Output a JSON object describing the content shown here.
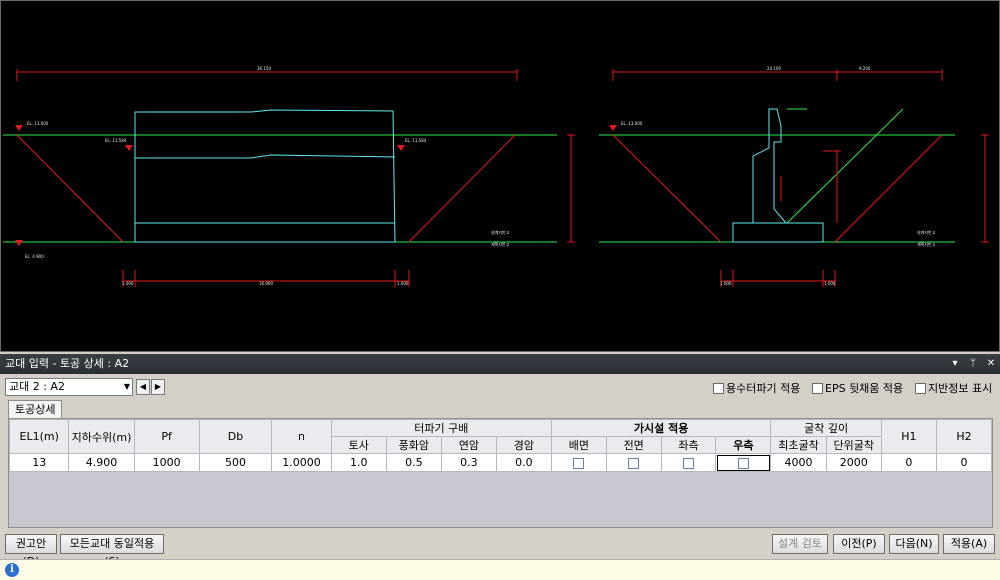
{
  "window": {
    "title": "교대 입력 - 토공 상세 : A2"
  },
  "title_controls": [
    "▾",
    "ᛘ",
    "✕"
  ],
  "selector": {
    "value": "교대 2 : A2"
  },
  "options": [
    {
      "label": "용수터파기 적용"
    },
    {
      "label": "EPS 뒷채움 적용"
    },
    {
      "label": "지반정보 표시"
    }
  ],
  "tab": {
    "label": "토공상세"
  },
  "table": {
    "group_headers": {
      "excavation_slope": "터파기 구배",
      "temporary": "가시설 적용",
      "depth": "굴착 깊이"
    },
    "columns": {
      "el1": "EL1(m)",
      "gwl": "지하수위(m)",
      "pf": "Pf",
      "db": "Db",
      "n": "n",
      "soil": "토사",
      "weathered": "풍화암",
      "soft": "연암",
      "hard": "경암",
      "back": "배면",
      "front": "전면",
      "left": "좌측",
      "right": "우측",
      "min_dig": "최초굴착",
      "unit_dig": "단위굴착",
      "h1": "H1",
      "h2": "H2"
    },
    "row": {
      "el1": "13",
      "gwl": "4.900",
      "pf": "1000",
      "db": "500",
      "n": "1.0000",
      "soil": "1.0",
      "weathered": "0.5",
      "soft": "0.3",
      "hard": "0.0",
      "back": false,
      "front": false,
      "left": false,
      "right": false,
      "min_dig": "4000",
      "unit_dig": "2000",
      "h1": "0",
      "h2": "0"
    }
  },
  "buttons": {
    "recommend": "권고안(D)",
    "apply_all": "모든교대 동일적용(S)",
    "design_check": "설계 검토",
    "prev": "이전(P)",
    "next": "다음(N)",
    "apply": "적용(A)"
  },
  "drawing": {
    "left_top_dim": "36.150",
    "left_el_top": "EL. 13.000",
    "left_el_mid": "EL. 11.584",
    "left_el_mid_r": "EL. 11.584",
    "left_el_bot": "EL. 4.900",
    "left_bot_dims": [
      "1.000",
      "16.900",
      "1.000"
    ],
    "left_water_labels": [
      "설계지반고",
      "계획지반고"
    ],
    "right_top_dims": [
      "24.100",
      "9.200"
    ],
    "right_el_top": "EL. 13.000",
    "right_bot_dims": [
      "1.000",
      "",
      "1.000"
    ],
    "right_water_labels": [
      "설계지반고",
      "계획지반고"
    ],
    "colors": {
      "cyan": "#5ee9f0",
      "green": "#2ee84a",
      "red": "#e11c1c"
    }
  }
}
